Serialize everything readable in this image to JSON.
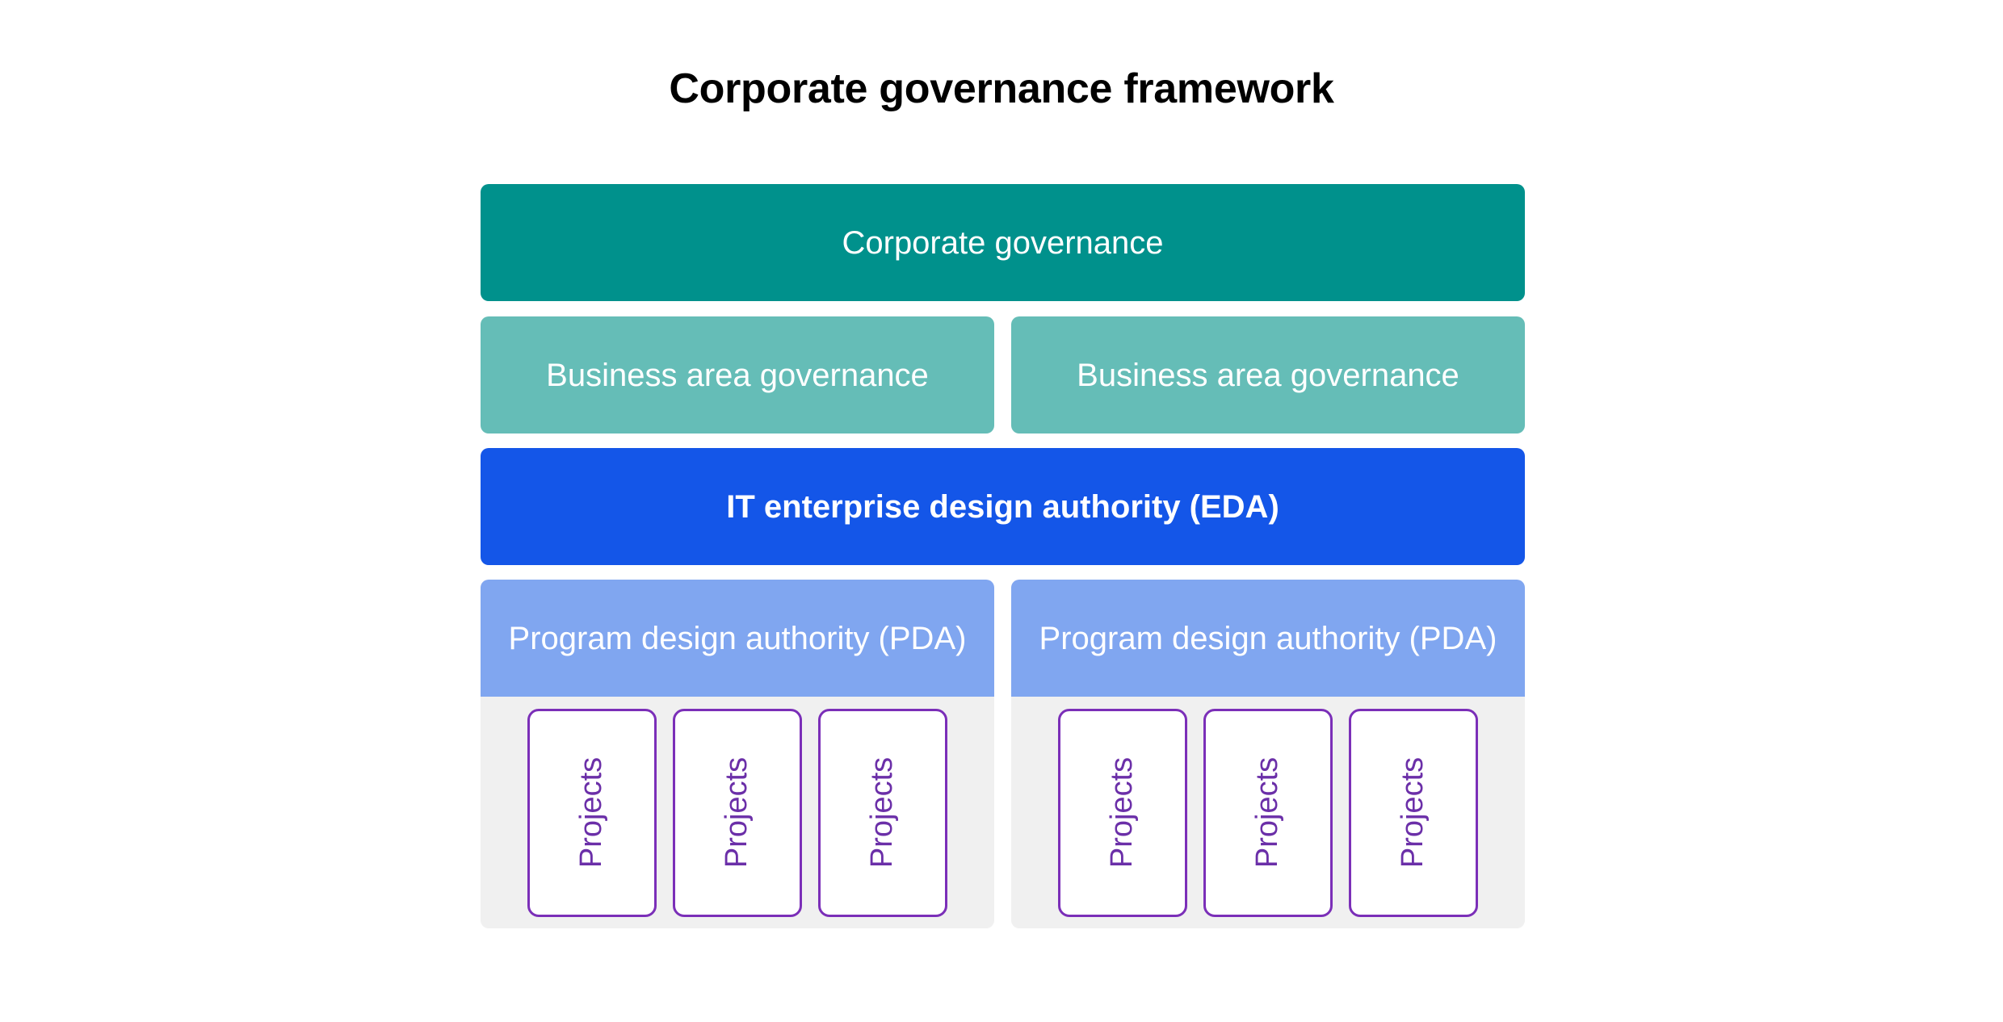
{
  "page": {
    "title": "Corporate governance framework",
    "background_color": "#ffffff"
  },
  "colors": {
    "corporate_governance": "#00918c",
    "business_area_governance": "#65bdb7",
    "eda": "#1456e8",
    "pda": "#80a6f0",
    "projects_well": "#f0f0f0",
    "project_border": "#7b2fb8",
    "project_text": "#6b2fa8",
    "box_text": "#ffffff",
    "title_text": "#000000"
  },
  "hierarchy": {
    "level_1": {
      "label": "Corporate governance"
    },
    "level_2": {
      "boxes": [
        {
          "label": "Business area governance"
        },
        {
          "label": "Business area governance"
        }
      ]
    },
    "level_3": {
      "label": "IT enterprise design authority (EDA)"
    },
    "level_4": {
      "columns": [
        {
          "label": "Program design authority (PDA)",
          "projects": [
            {
              "label": "Projects"
            },
            {
              "label": "Projects"
            },
            {
              "label": "Projects"
            }
          ]
        },
        {
          "label": "Program design authority (PDA)",
          "projects": [
            {
              "label": "Projects"
            },
            {
              "label": "Projects"
            },
            {
              "label": "Projects"
            }
          ]
        }
      ]
    }
  }
}
